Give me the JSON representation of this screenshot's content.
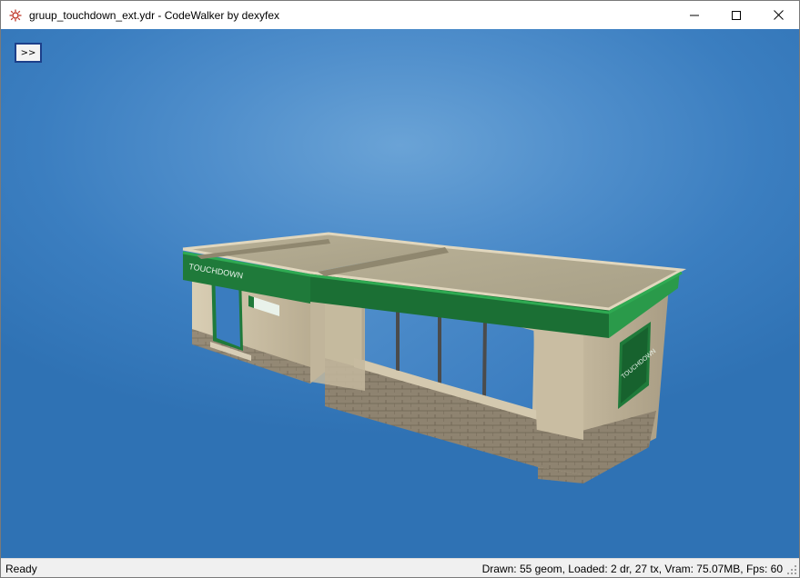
{
  "window": {
    "title": "gruup_touchdown_ext.ydr - CodeWalker by dexyfex",
    "icon": "codewalker-app-icon"
  },
  "caption_buttons": [
    "minimize-icon",
    "maximize-icon",
    "close-icon"
  ],
  "viewport": {
    "toggle_label": ">>",
    "scene": {
      "object": "3D building model",
      "roof_sign_text": "TOUCHDOWN",
      "side_sign_text": "TOUCHDOWN"
    }
  },
  "status": {
    "left": "Ready",
    "right": "Drawn: 55 geom, Loaded: 2 dr, 27 tx, Vram: 75.07MB, Fps: 60"
  },
  "colors": {
    "sky_top": "#6aa3d6",
    "sky_bottom": "#2f72b4",
    "brand_green": "#1f7a3a",
    "wall_beige": "#cfc3a8"
  }
}
